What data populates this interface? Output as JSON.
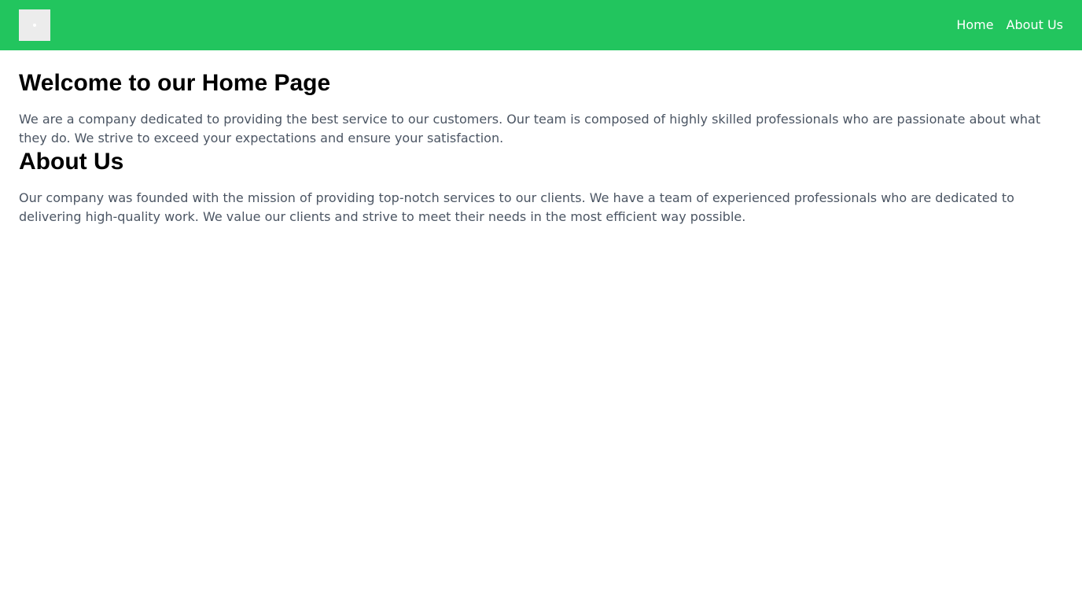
{
  "header": {
    "nav": [
      {
        "label": "Home"
      },
      {
        "label": "About Us"
      }
    ],
    "colors": {
      "background": "#22c55e",
      "text": "#ffffff"
    },
    "logo_icon": "logo-placeholder-icon"
  },
  "main": {
    "welcome": {
      "heading": "Welcome to our Home Page",
      "text": "We are a company dedicated to providing the best service to our customers. Our team is composed of highly skilled professionals who are passionate about what they do. We strive to exceed your expectations and ensure your satisfaction."
    },
    "about": {
      "heading": "About Us",
      "text": "Our company was founded with the mission of providing top-notch services to our clients. We have a team of experienced professionals who are dedicated to delivering high-quality work. We value our clients and strive to meet their needs in the most efficient way possible."
    }
  }
}
